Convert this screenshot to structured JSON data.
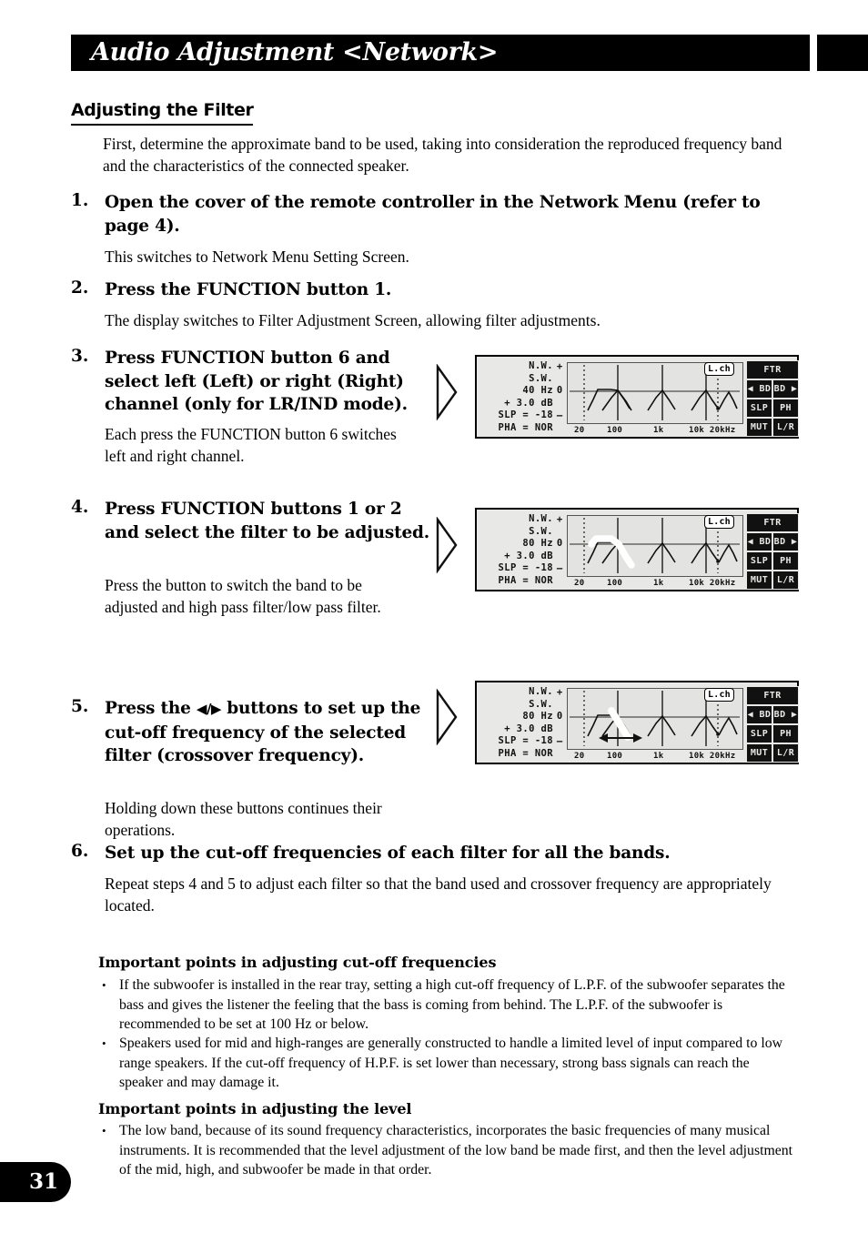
{
  "header": {
    "title": "Audio Adjustment <Network>"
  },
  "section": {
    "heading": "Adjusting the Filter",
    "intro": "First, determine the approximate band to be used, taking into consideration the reproduced frequency band and the characteristics of the connected speaker."
  },
  "steps": [
    {
      "num": "1.",
      "title": "Open the cover of the remote controller in the Network Menu (refer to page 4).",
      "body": "This switches to Network Menu Setting Screen."
    },
    {
      "num": "2.",
      "title": "Press the FUNCTION button 1.",
      "body": "The display switches to Filter Adjustment Screen, allowing filter adjustments."
    },
    {
      "num": "3.",
      "title": "Press FUNCTION button 6 and select left (Left) or right (Right) channel (only for LR/IND mode).",
      "body": "Each press the FUNCTION button 6 switches left and right channel."
    },
    {
      "num": "4.",
      "title": "Press FUNCTION buttons 1 or 2 and select the filter to be adjusted.",
      "body": "Press the button to switch the band to be adjusted and high pass filter/low pass filter."
    },
    {
      "num": "5.",
      "title_pre": "Press the ",
      "title_arrows": "◀/▶",
      "title_post": " buttons to set up the cut-off frequency of the selected filter (crossover frequency).",
      "body": "Holding down these buttons continues their operations."
    },
    {
      "num": "6.",
      "title": "Set up the cut-off frequencies of each filter for all the bands.",
      "body": "Repeat steps 4 and 5 to adjust each filter so that the band used and crossover frequency are appropriately located."
    }
  ],
  "displays": [
    {
      "status": [
        "N.W.",
        "S.W.",
        "40 Hz",
        "+ 3.0 dB",
        "SLP = -18",
        "PHA = NOR"
      ],
      "gain_axis": {
        "plus": "+",
        "zero": "0",
        "minus": "–"
      },
      "x_labels": [
        "20",
        "100",
        "1k",
        "10k 20kHz"
      ],
      "channel_badge": "L.ch",
      "buttons": {
        "header": "FTR",
        "band_prev": "◀ BD",
        "band_next": "BD ▶",
        "slope": "SLP",
        "phase": "PH",
        "mute": "MUT",
        "left_right": "L/R"
      },
      "selection": "none",
      "marker": "none"
    },
    {
      "status": [
        "N.W.",
        "S.W.",
        "80 Hz",
        "+ 3.0 dB",
        "SLP = -18",
        "PHA = NOR"
      ],
      "gain_axis": {
        "plus": "+",
        "zero": "0",
        "minus": "–"
      },
      "x_labels": [
        "20",
        "100",
        "1k",
        "10k 20kHz"
      ],
      "channel_badge": "L.ch",
      "buttons": {
        "header": "FTR",
        "band_prev": "◀ BD",
        "band_next": "BD ▶",
        "slope": "SLP",
        "phase": "PH",
        "mute": "MUT",
        "left_right": "L/R"
      },
      "selection": "band-outlined",
      "marker": "none"
    },
    {
      "status": [
        "N.W.",
        "S.W.",
        "80 Hz",
        "+ 3.0 dB",
        "SLP = -18",
        "PHA = NOR"
      ],
      "gain_axis": {
        "plus": "+",
        "zero": "0",
        "minus": "–"
      },
      "x_labels": [
        "20",
        "100",
        "1k",
        "10k 20kHz"
      ],
      "channel_badge": "L.ch",
      "buttons": {
        "header": "FTR",
        "band_prev": "◀ BD",
        "band_next": "BD ▶",
        "slope": "SLP",
        "phase": "PH",
        "mute": "MUT",
        "left_right": "L/R"
      },
      "selection": "slope-outlined",
      "marker": "horizontal-double-arrow"
    }
  ],
  "notes": [
    {
      "heading": "Important points in adjusting cut-off frequencies",
      "bullets": [
        "If the subwoofer is installed in the rear tray, setting a high cut-off frequency of L.P.F. of the subwoofer separates the bass and gives the listener the feeling that the bass is coming from behind. The L.P.F. of the subwoofer is recommended to be set at 100 Hz or below.",
        "Speakers used for mid and high-ranges are generally constructed to handle a limited level of input compared to low range speakers. If the cut-off frequency of H.P.F. is set lower than necessary, strong bass signals can reach the speaker and may damage it."
      ]
    },
    {
      "heading": "Important points in adjusting the level",
      "bullets": [
        "The low band, because of its sound frequency characteristics, incorporates the basic frequencies of many musical instruments. It is recommended that the level adjustment of the low band be made first, and then the level adjustment of the mid, high, and subwoofer be made in that order."
      ]
    }
  ],
  "footer": {
    "page_number": "31"
  },
  "bullet_char": "•"
}
